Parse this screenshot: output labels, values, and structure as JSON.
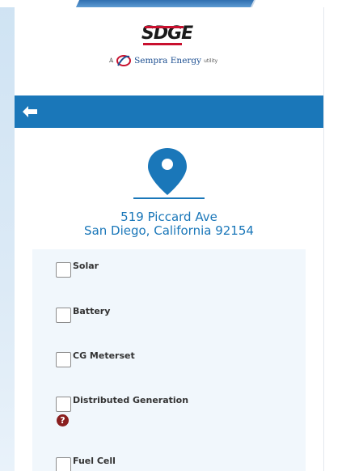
{
  "header": {
    "logo_text": "SDGE",
    "logo_prefix": "A",
    "logo_company": "Sempra Energy",
    "logo_suffix": "utility",
    "brand_red": "#c8102e",
    "brand_blue": "#1a77b9"
  },
  "nav": {
    "back_icon": "arrow-left-icon"
  },
  "location": {
    "icon": "map-pin-icon",
    "line1": "519 Piccard Ave",
    "line2": "San Diego, California 92154"
  },
  "options": [
    {
      "label": "Solar",
      "checked": false
    },
    {
      "label": "Battery",
      "checked": false
    },
    {
      "label": "CG Meterset",
      "checked": false
    },
    {
      "label": "Distributed Generation",
      "checked": false
    },
    {
      "label": "Fuel Cell",
      "checked": false
    }
  ],
  "help": {
    "icon": "question-circle-icon",
    "glyph": "?"
  }
}
